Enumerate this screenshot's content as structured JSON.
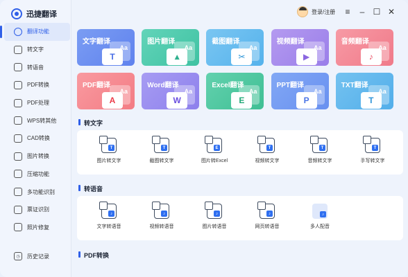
{
  "app": {
    "name": "迅捷翻译",
    "user_label": "登录/注册"
  },
  "window_controls": [
    "menu-icon",
    "minimize-icon",
    "maximize-icon",
    "close-icon"
  ],
  "sidebar": {
    "items": [
      {
        "label": "翻译功能",
        "icon": "translate-icon",
        "active": true
      },
      {
        "label": "转文字",
        "icon": "text-icon",
        "active": false
      },
      {
        "label": "转语音",
        "icon": "voice-icon",
        "active": false
      },
      {
        "label": "PDF转换",
        "icon": "pdf-convert-icon",
        "active": false
      },
      {
        "label": "PDF处理",
        "icon": "pdf-process-icon",
        "active": false
      },
      {
        "label": "WPS转其他",
        "icon": "wps-icon",
        "active": false
      },
      {
        "label": "CAD转换",
        "icon": "cad-icon",
        "active": false
      },
      {
        "label": "图片转换",
        "icon": "image-icon",
        "active": false
      },
      {
        "label": "压缩功能",
        "icon": "compress-icon",
        "active": false
      },
      {
        "label": "多功能识别",
        "icon": "recognize-icon",
        "active": false
      },
      {
        "label": "票证识别",
        "icon": "ticket-icon",
        "active": false
      },
      {
        "label": "照片修复",
        "icon": "photo-repair-icon",
        "active": false
      }
    ],
    "history_label": "历史记录"
  },
  "translate_cards": [
    {
      "label": "文字翻译",
      "glyph": "T",
      "color": "#7b9df3",
      "color2": "#5f82ee",
      "glyph_color": "#4a6fe6"
    },
    {
      "label": "图片翻译",
      "glyph": "▲",
      "color": "#62d4b9",
      "color2": "#3fc2a2",
      "glyph_color": "#2fb08e"
    },
    {
      "label": "截图翻译",
      "glyph": "✂",
      "color": "#7ac6f2",
      "color2": "#55b2ec",
      "glyph_color": "#2f96d8"
    },
    {
      "label": "视频翻译",
      "glyph": "▶",
      "color": "#b49af0",
      "color2": "#9a7ee9",
      "glyph_color": "#8b67e0"
    },
    {
      "label": "音频翻译",
      "glyph": "♪",
      "color": "#f79aa5",
      "color2": "#f07a89",
      "glyph_color": "#e8485e"
    },
    {
      "label": "PDF翻译",
      "glyph": "A",
      "color": "#f99aa0",
      "color2": "#f37c84",
      "glyph_color": "#ec3b48"
    },
    {
      "label": "Word翻译",
      "glyph": "W",
      "color": "#a79cf3",
      "color2": "#8d80ec",
      "glyph_color": "#6b4fe0"
    },
    {
      "label": "Excel翻译",
      "glyph": "E",
      "color": "#63d1ae",
      "color2": "#3fbf94",
      "glyph_color": "#22a877"
    },
    {
      "label": "PPT翻译",
      "glyph": "P",
      "color": "#82a8f5",
      "color2": "#6890f0",
      "glyph_color": "#4a74e6"
    },
    {
      "label": "TXT翻译",
      "glyph": "T",
      "color": "#74c2f0",
      "color2": "#52aeea",
      "glyph_color": "#2f94d8"
    }
  ],
  "sections": [
    {
      "title": "转文字",
      "tools": [
        {
          "label": "图片转文字",
          "icon": "image-to-text-icon",
          "inner": "T"
        },
        {
          "label": "截图转文字",
          "icon": "screenshot-to-text-icon",
          "inner": "T"
        },
        {
          "label": "图片转Excel",
          "icon": "image-to-excel-icon",
          "inner": "E"
        },
        {
          "label": "视频转文字",
          "icon": "video-to-text-icon",
          "inner": "T"
        },
        {
          "label": "音频转文字",
          "icon": "audio-to-text-icon",
          "inner": "T"
        },
        {
          "label": "手写转文字",
          "icon": "handwriting-to-text-icon",
          "inner": "T"
        }
      ]
    },
    {
      "title": "转语音",
      "tools": [
        {
          "label": "文字转语音",
          "icon": "text-to-speech-icon",
          "inner": "♪"
        },
        {
          "label": "视频转语音",
          "icon": "video-to-speech-icon",
          "inner": "♪"
        },
        {
          "label": "图片转语音",
          "icon": "image-to-speech-icon",
          "inner": "♪"
        },
        {
          "label": "网页转语音",
          "icon": "webpage-to-speech-icon",
          "inner": "♪"
        },
        {
          "label": "多人配音",
          "icon": "multi-voice-dubbing-icon",
          "inner": "♪"
        }
      ]
    },
    {
      "title": "PDF转换",
      "tools": []
    }
  ]
}
